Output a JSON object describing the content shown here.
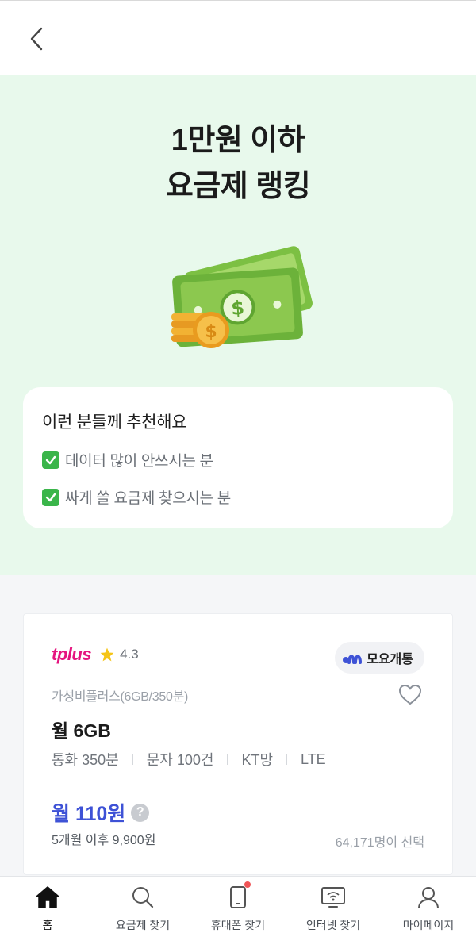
{
  "header": {
    "back_icon": "chevron-left-icon"
  },
  "hero": {
    "title_line1": "1만원 이하",
    "title_line2": "요금제 랭킹",
    "illustration": "money-bills-coins-icon"
  },
  "recommend": {
    "title": "이런 분들께 추천해요",
    "items": [
      {
        "label": "데이터 많이 안쓰시는 분",
        "icon": "check-box-icon"
      },
      {
        "label": "싸게 쓸 요금제 찾으시는 분",
        "icon": "check-box-icon"
      }
    ]
  },
  "plan": {
    "brand": "tplus",
    "rating": "4.3",
    "badge": "모요개통",
    "name": "가성비플러스(6GB/350분)",
    "data": "월 6GB",
    "specs": [
      "통화 350분",
      "문자 100건",
      "KT망",
      "LTE"
    ],
    "price": "월 110원",
    "help": "?",
    "after_price": "5개월 이후 9,900원",
    "selected_count": "64,171명이 선택"
  },
  "nav": {
    "items": [
      {
        "label": "홈",
        "icon": "home-icon",
        "active": true
      },
      {
        "label": "요금제 찾기",
        "icon": "search-icon"
      },
      {
        "label": "휴대폰 찾기",
        "icon": "phone-icon",
        "badge": true
      },
      {
        "label": "인터넷 찾기",
        "icon": "wifi-monitor-icon"
      },
      {
        "label": "마이페이지",
        "icon": "user-icon"
      }
    ]
  },
  "colors": {
    "hero_bg": "#e8f9ec",
    "accent": "#3e52d6",
    "brand_pink": "#e5147f",
    "check_green": "#3ab54a",
    "notification": "#f05456"
  }
}
